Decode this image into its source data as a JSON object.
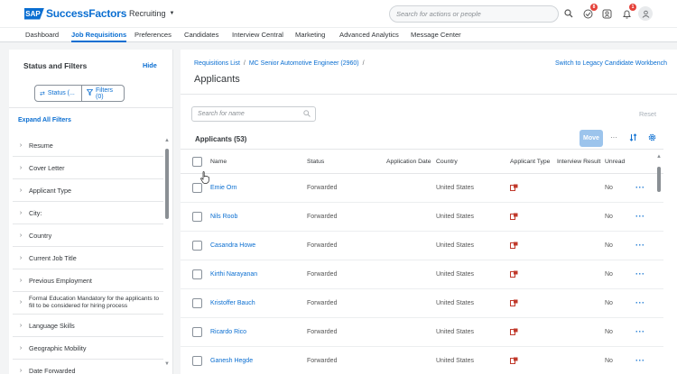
{
  "header": {
    "logo_sap": "SAP",
    "logo_text": "SuccessFactors",
    "module": "Recruiting",
    "search_placeholder": "Search for actions or people",
    "badges": {
      "approvals": "8",
      "notifications": "1"
    }
  },
  "tabs": [
    {
      "label": "Dashboard"
    },
    {
      "label": "Job Requisitions"
    },
    {
      "label": "Preferences"
    },
    {
      "label": "Candidates"
    },
    {
      "label": "Interview Central"
    },
    {
      "label": "Marketing"
    },
    {
      "label": "Advanced Analytics"
    },
    {
      "label": "Message Center"
    }
  ],
  "left": {
    "title": "Status and Filters",
    "hide": "Hide",
    "status_btn": "Status (...",
    "filters_btn": "Filters (0)",
    "expand_all": "Expand All Filters",
    "filters": [
      "Resume",
      "Cover Letter",
      "Applicant Type",
      "City:",
      "Country",
      "Current Job Title",
      "Previous Employment",
      "Formal Education Mandatory for the applicants to fill to be considered for hiring process",
      "Language Skills",
      "Geographic Mobility",
      "Date Forwarded"
    ]
  },
  "main": {
    "crumb1": "Requisitions List",
    "crumb2": "MC Senior Automotive Engineer (2960)",
    "crumb_sep": "/",
    "legacy_link": "Switch to Legacy Candidate Workbench",
    "title": "Applicants",
    "name_search_placeholder": "Search for name",
    "reset": "Reset",
    "table_title": "Applicants (53)",
    "move": "Move",
    "columns": {
      "name": "Name",
      "status": "Status",
      "app_date": "Application Date",
      "country": "Country",
      "app_type": "Applicant Type",
      "interview": "Interview Result",
      "unread": "Unread"
    },
    "rows": [
      {
        "name": "Emie Orn",
        "status": "Forwarded",
        "country": "United States",
        "unread": "No"
      },
      {
        "name": "Nils Roob",
        "status": "Forwarded",
        "country": "United States",
        "unread": "No"
      },
      {
        "name": "Casandra Howe",
        "status": "Forwarded",
        "country": "United States",
        "unread": "No"
      },
      {
        "name": "Kirthi Narayanan",
        "status": "Forwarded",
        "country": "United States",
        "unread": "No"
      },
      {
        "name": "Kristoffer Bauch",
        "status": "Forwarded",
        "country": "United States",
        "unread": "No"
      },
      {
        "name": "Ricardo Rico",
        "status": "Forwarded",
        "country": "United States",
        "unread": "No"
      },
      {
        "name": "Ganesh Hegde",
        "status": "Forwarded",
        "country": "United States",
        "unread": "No"
      }
    ]
  },
  "colors": {
    "accent": "#0a6ed1",
    "applicant_type_icon": "#c0392b"
  }
}
